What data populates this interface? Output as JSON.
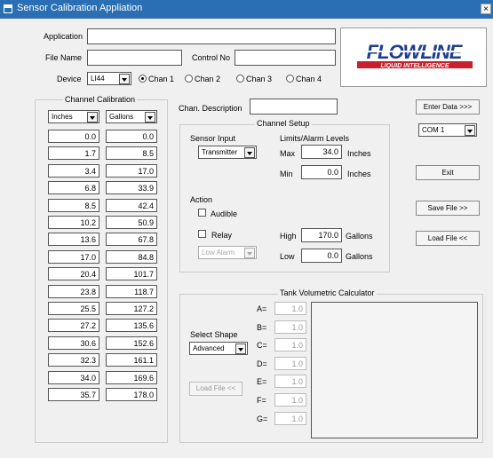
{
  "window": {
    "title": "Sensor Calibration Appliation",
    "close_glyph": "×"
  },
  "form": {
    "application_label": "Application",
    "application_value": "",
    "filename_label": "File Name",
    "filename_value": "",
    "control_label": "Control No",
    "control_value": "",
    "device_label": "Device",
    "device_value": "LI44",
    "channels": [
      "Chan 1",
      "Chan 2",
      "Chan 3",
      "Chan 4"
    ],
    "selected_channel": 0
  },
  "logo": {
    "line1": "FLOWLINE",
    "line2": "LIQUID INTELLIGENCE"
  },
  "calibration": {
    "title": "Channel Calibration",
    "unit_left": "Inches",
    "unit_right": "Gallons",
    "rows": [
      [
        "0.0",
        "0.0"
      ],
      [
        "1.7",
        "8.5"
      ],
      [
        "3.4",
        "17.0"
      ],
      [
        "6.8",
        "33.9"
      ],
      [
        "8.5",
        "42.4"
      ],
      [
        "10.2",
        "50.9"
      ],
      [
        "13.6",
        "67.8"
      ],
      [
        "17.0",
        "84.8"
      ],
      [
        "20.4",
        "101.7"
      ],
      [
        "23.8",
        "118.7"
      ],
      [
        "25.5",
        "127.2"
      ],
      [
        "27.2",
        "135.6"
      ],
      [
        "30.6",
        "152.6"
      ],
      [
        "32.3",
        "161.1"
      ],
      [
        "34.0",
        "169.6"
      ],
      [
        "35.7",
        "178.0"
      ]
    ]
  },
  "chan_desc": {
    "label": "Chan. Description",
    "value": ""
  },
  "setup": {
    "title": "Channel Setup",
    "sensor_label": "Sensor Input",
    "sensor_value": "Transmitter",
    "limits_label": "Limits/Alarm Levels",
    "max_label": "Max",
    "max_value": "34.0",
    "max_unit": "Inches",
    "min_label": "Min",
    "min_value": "0.0",
    "min_unit": "Inches",
    "action_label": "Action",
    "audible_label": "Audible",
    "relay_label": "Relay",
    "alarm_value": "Low Alarm",
    "high_label": "High",
    "high_value": "170.0",
    "high_unit": "Gallons",
    "low_label": "Low",
    "low_value": "0.0",
    "low_unit": "Gallons"
  },
  "buttons": {
    "enter_data": "Enter Data >>>",
    "com_port": "COM 1",
    "exit": "Exit",
    "save_file": "Save File >>",
    "load_file": "Load File <<"
  },
  "calculator": {
    "title": "Tank Volumetric Calculator",
    "shape_label": "Select Shape",
    "shape_value": "Advanced",
    "load_file": "Load File <<",
    "params": [
      {
        "label": "A=",
        "value": "1.0"
      },
      {
        "label": "B=",
        "value": "1.0"
      },
      {
        "label": "C=",
        "value": "1.0"
      },
      {
        "label": "D=",
        "value": "1.0"
      },
      {
        "label": "E=",
        "value": "1.0"
      },
      {
        "label": "F=",
        "value": "1.0"
      },
      {
        "label": "G=",
        "value": "1.0"
      }
    ]
  },
  "colors": {
    "titlebar": "#2a6fb3",
    "logo_blue": "#1d3d8f",
    "logo_red": "#c8202c"
  }
}
